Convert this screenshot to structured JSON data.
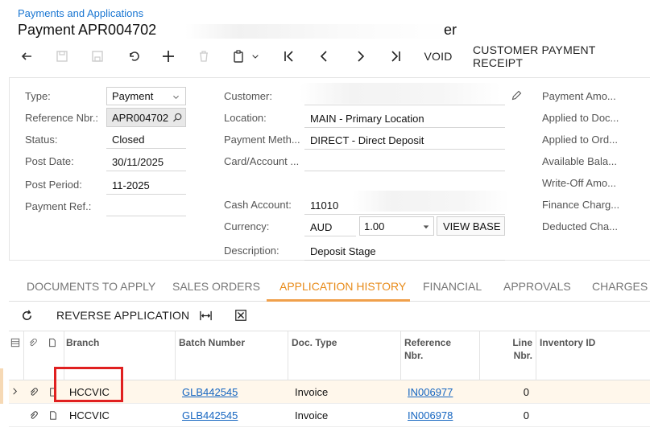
{
  "breadcrumb": "Payments and Applications",
  "title": "Payment APR004702",
  "title_tail": "er",
  "toolbar": {
    "void_label": "VOID",
    "customer_payment_receipt_label": "CUSTOMER PAYMENT RECEIPT"
  },
  "form": {
    "type_label": "Type:",
    "type_value": "Payment",
    "ref_label": "Reference Nbr.:",
    "ref_value": "APR004702",
    "status_label": "Status:",
    "status_value": "Closed",
    "post_date_label": "Post Date:",
    "post_date_value": "30/11/2025",
    "post_period_label": "Post Period:",
    "post_period_value": "11-2025",
    "payment_ref_label": "Payment Ref.:",
    "customer_label": "Customer:",
    "location_label": "Location:",
    "location_value": "MAIN - Primary Location",
    "payment_method_label": "Payment Meth...",
    "payment_method_value": "DIRECT - Direct Deposit",
    "card_account_label": "Card/Account ...",
    "cash_account_label": "Cash Account:",
    "cash_account_value": "11010",
    "currency_label": "Currency:",
    "currency_value": "AUD",
    "rate_value": "1.00",
    "view_base_label": "VIEW BASE",
    "description_label": "Description:",
    "description_value": "Deposit Stage",
    "right_labels": [
      "Payment Amo...",
      "Applied to Doc...",
      "Applied to Ord...",
      "Available Bala...",
      "Write-Off Amo...",
      "Finance Charg...",
      "Deducted Cha..."
    ]
  },
  "tabs": [
    "DOCUMENTS TO APPLY",
    "SALES ORDERS",
    "APPLICATION HISTORY",
    "FINANCIAL",
    "APPROVALS",
    "CHARGES"
  ],
  "grid_toolbar": {
    "reverse_label": "REVERSE APPLICATION"
  },
  "grid": {
    "headers": {
      "branch": "Branch",
      "batch": "Batch Number",
      "doc_type": "Doc. Type",
      "reference_1": "Reference",
      "reference_2": "Nbr.",
      "line_1": "Line",
      "line_2": "Nbr.",
      "inventory": "Inventory ID"
    },
    "rows": [
      {
        "branch": "HCCVIC",
        "batch": "GLB442545",
        "doc_type": "Invoice",
        "reference": "IN006977",
        "line": "0"
      },
      {
        "branch": "HCCVIC",
        "batch": "GLB442545",
        "doc_type": "Invoice",
        "reference": "IN006978",
        "line": "0"
      }
    ]
  },
  "colors": {
    "accent": "#e88b1a",
    "link": "#1565c0",
    "highlight": "#e02020"
  }
}
